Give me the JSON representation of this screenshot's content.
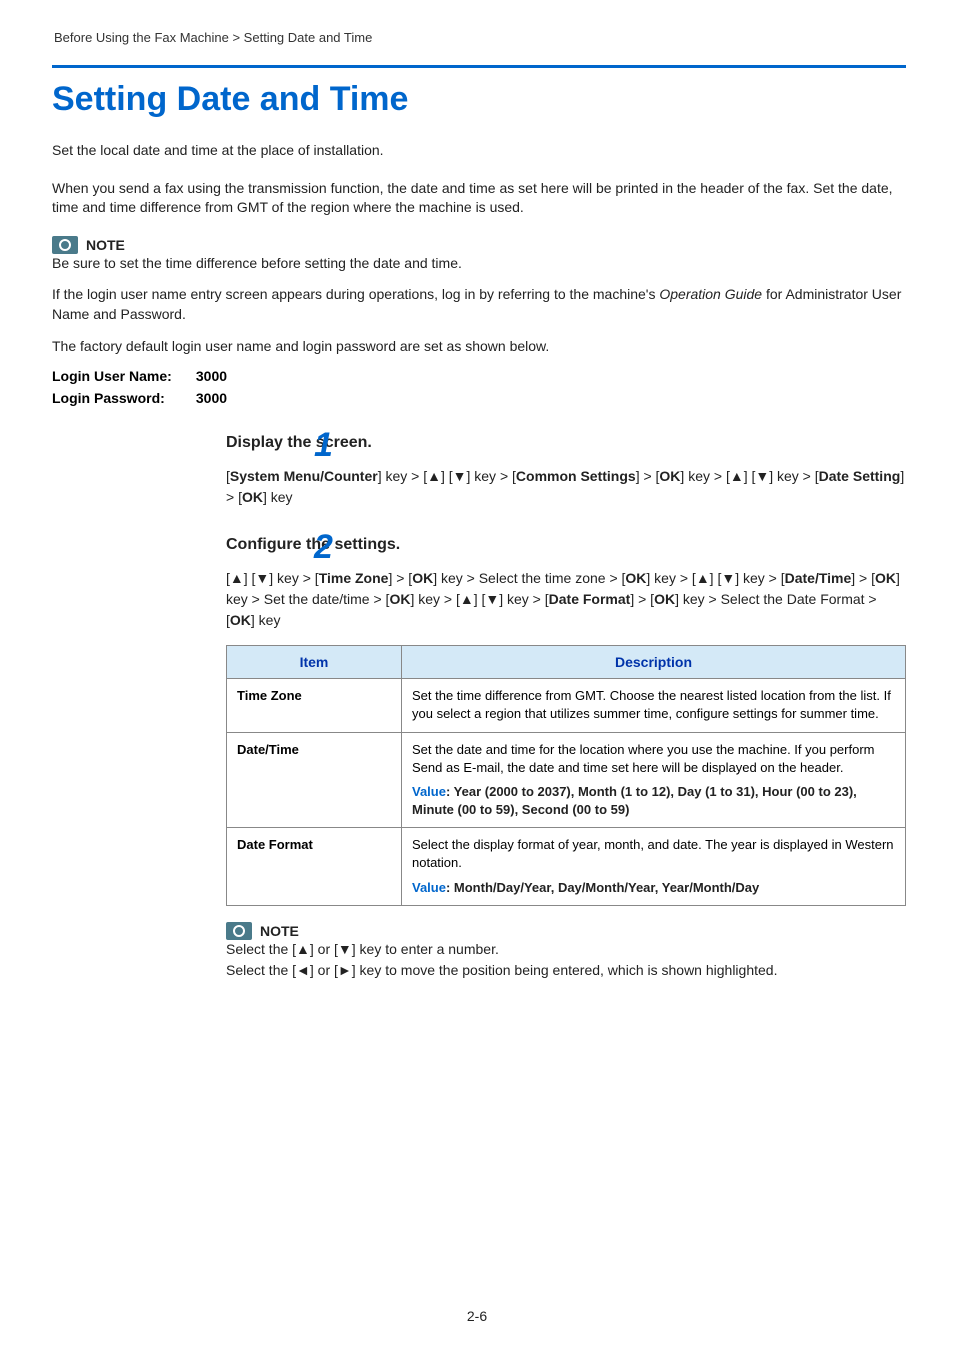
{
  "breadcrumb": "Before Using the Fax Machine > Setting Date and Time",
  "title": "Setting Date and Time",
  "intro1": "Set the local date and time at the place of installation.",
  "intro2": "When you send a fax using the transmission function, the date and time as set here will be printed in the header of the fax. Set the date, time and time difference from GMT of the region where the machine is used.",
  "note1": {
    "label": "NOTE",
    "line1": "Be sure to set the time difference before setting the date and time.",
    "line2a": "If the login user name entry screen appears during operations, log in by referring to the machine's ",
    "line2italic": "Operation Guide",
    "line2b": " for Administrator User Name and Password.",
    "line3": "The factory default login user name and login password are set as shown below."
  },
  "login": {
    "userNameLabel": "Login User Name:",
    "userNameValue": "3000",
    "passwordLabel": "Login Password:",
    "passwordValue": "3000"
  },
  "step1": {
    "number": "1",
    "title": "Display the screen.",
    "body_parts": {
      "p0": "[",
      "p1": "System Menu/Counter",
      "p2": "] key > [▲] [▼] key > [",
      "p3": "Common Settings",
      "p4": "] > [",
      "p5": "OK",
      "p6": "] key > [▲] [▼] key > [",
      "p7": "Date Setting",
      "p8": "] > [",
      "p9": "OK",
      "p10": "] key"
    }
  },
  "step2": {
    "number": "2",
    "title": "Configure the settings.",
    "body_parts": {
      "p0": "[▲] [▼] key > [",
      "p1": "Time Zone",
      "p2": "] > [",
      "p3": "OK",
      "p4": "] key > Select the time zone > [",
      "p5": "OK",
      "p6": "] key > [▲] [▼] key > [",
      "p7": "Date/Time",
      "p8": "] > [",
      "p9": "OK",
      "p10": "] key > Set the date/time > [",
      "p11": "OK",
      "p12": "] key > [▲] [▼] key > [",
      "p13": "Date Format",
      "p14": "] > [",
      "p15": "OK",
      "p16": "] key > Select the Date Format > [",
      "p17": "OK",
      "p18": "] key"
    }
  },
  "table": {
    "headers": {
      "item": "Item",
      "description": "Description"
    },
    "rows": {
      "r0": {
        "item": "Time Zone",
        "desc": "Set the time difference from GMT. Choose the nearest listed location from the list. If you select a region that utilizes summer time, configure settings for summer time."
      },
      "r1": {
        "item": "Date/Time",
        "desc": "Set the date and time for the location where you use the machine. If you perform Send as E-mail, the date and time set here will be displayed on the header.",
        "valueLabel": "Value",
        "valueText": ": Year (2000 to 2037), Month (1 to 12), Day (1 to 31), Hour (00 to 23), Minute (00 to 59), Second (00 to 59)"
      },
      "r2": {
        "item": "Date Format",
        "desc": "Select the display format of year, month, and date. The year is displayed in Western notation.",
        "valueLabel": "Value",
        "valueText": ": Month/Day/Year, Day/Month/Year, Year/Month/Day"
      }
    }
  },
  "note2": {
    "label": "NOTE",
    "line1": "Select the [▲] or [▼] key to enter a number.",
    "line2": "Select the [◄] or [►] key to move the position being entered, which is shown highlighted."
  },
  "pageNumber": "2-6"
}
